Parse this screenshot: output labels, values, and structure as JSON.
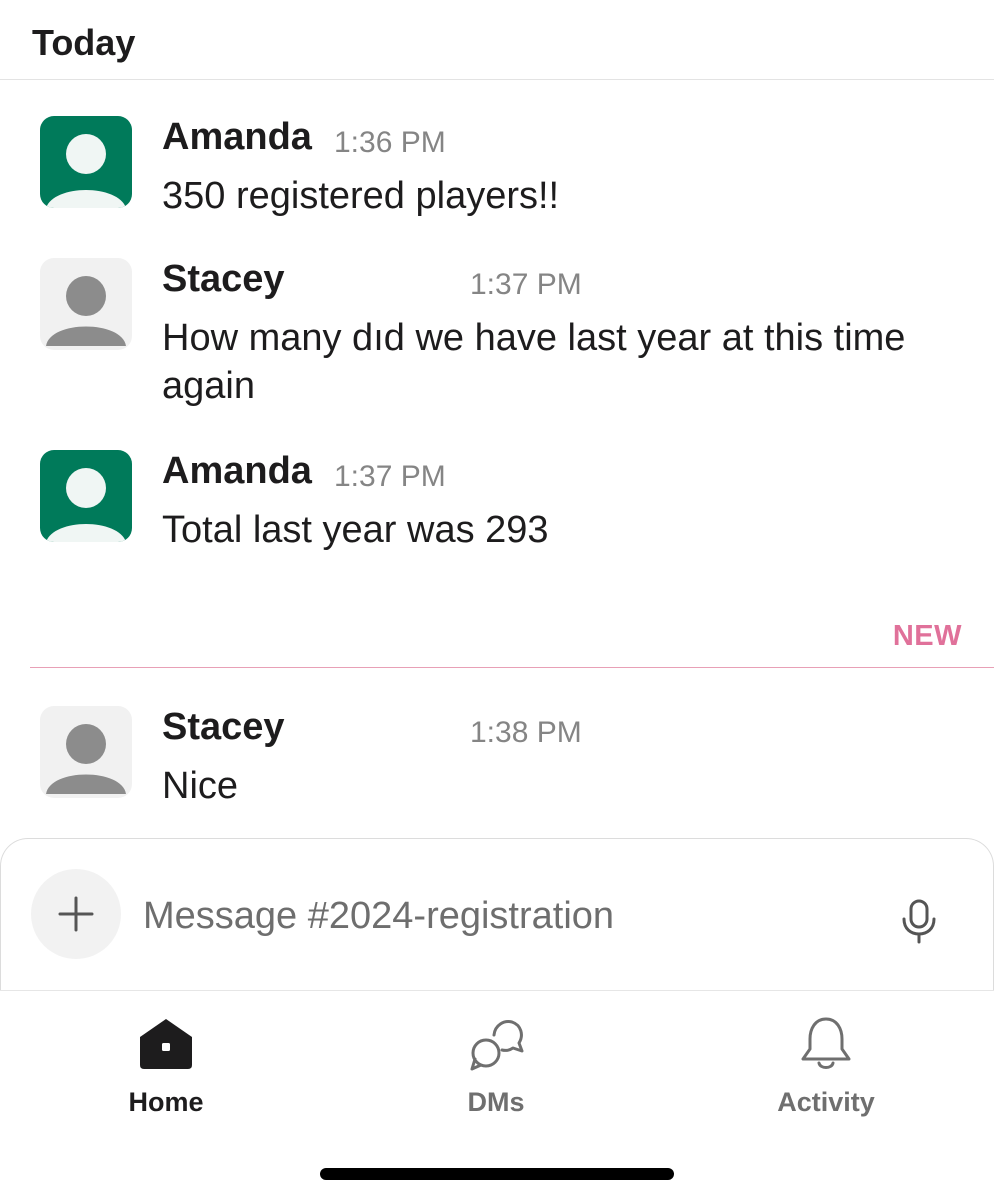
{
  "day_header": "Today",
  "colors": {
    "accent_green": "#007a5a",
    "new_divider": "#e0719a",
    "text": "#1d1c1d",
    "muted": "#858585"
  },
  "messages": [
    {
      "author": "Amanda",
      "time": "1:36 PM",
      "text": "350 registered players!!",
      "avatar": "green-user-icon"
    },
    {
      "author": "Stacey",
      "time": "1:37 PM",
      "text": "How many dıd we have last year at this time again",
      "avatar": "gray-user-icon"
    },
    {
      "author": "Amanda",
      "time": "1:37 PM",
      "text": "Total last year was 293",
      "avatar": "green-user-icon"
    },
    {
      "author": "Stacey",
      "time": "1:38 PM",
      "text": "Nice",
      "avatar": "gray-user-icon"
    }
  ],
  "new_label": "NEW",
  "composer": {
    "placeholder": "Message #2024-registration",
    "value": ""
  },
  "tabs": [
    {
      "label": "Home",
      "icon": "home-icon",
      "active": true
    },
    {
      "label": "DMs",
      "icon": "dms-icon",
      "active": false
    },
    {
      "label": "Activity",
      "icon": "bell-icon",
      "active": false
    }
  ]
}
